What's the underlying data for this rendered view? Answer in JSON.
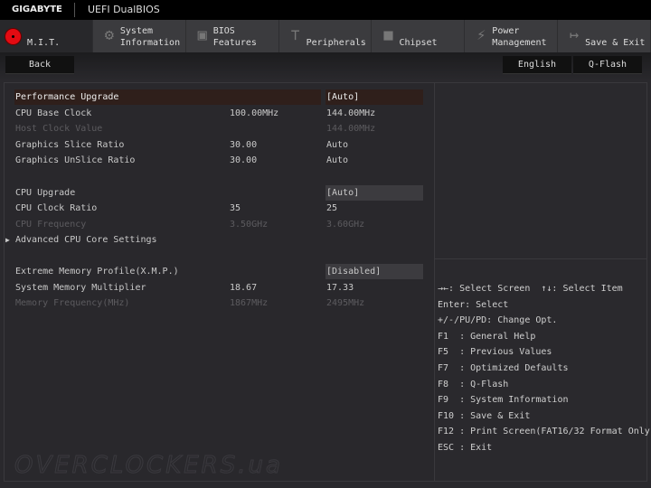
{
  "header": {
    "brand": "GIGABYTE",
    "title": "UEFI DualBIOS"
  },
  "tabs": [
    {
      "label1": "",
      "label2": "M.I.T.",
      "icon": "mit-icon"
    },
    {
      "label1": "System",
      "label2": "Information",
      "icon": "gear-icon"
    },
    {
      "label1": "BIOS",
      "label2": "Features",
      "icon": "bios-chip-icon"
    },
    {
      "label1": "",
      "label2": "Peripherals",
      "icon": "peripherals-icon"
    },
    {
      "label1": "",
      "label2": "Chipset",
      "icon": "chipset-icon"
    },
    {
      "label1": "Power",
      "label2": "Management",
      "icon": "power-icon"
    },
    {
      "label1": "",
      "label2": "Save & Exit",
      "icon": "exit-icon"
    }
  ],
  "toolbar": {
    "back": "Back",
    "language": "English",
    "qflash": "Q-Flash"
  },
  "settings": [
    {
      "name": "Performance Upgrade",
      "current": "",
      "value": "[Auto]",
      "state": "selected"
    },
    {
      "name": "CPU Base Clock",
      "current": "100.00MHz",
      "value": "144.00MHz",
      "state": "normal"
    },
    {
      "name": "Host Clock Value",
      "current": "",
      "value": "144.00MHz",
      "state": "disabled"
    },
    {
      "name": "Graphics Slice Ratio",
      "current": "30.00",
      "value": "Auto",
      "state": "normal"
    },
    {
      "name": "Graphics UnSlice Ratio",
      "current": "30.00",
      "value": "Auto",
      "state": "normal"
    },
    {
      "name": "CPU Upgrade",
      "current": "",
      "value": "[Auto]",
      "state": "box"
    },
    {
      "name": "CPU Clock Ratio",
      "current": "35",
      "value": "25",
      "state": "normal"
    },
    {
      "name": "CPU Frequency",
      "current": "3.50GHz",
      "value": "3.60GHz",
      "state": "disabled"
    },
    {
      "name": "Advanced CPU Core Settings",
      "current": "",
      "value": "",
      "state": "submenu"
    },
    {
      "name": "Extreme Memory Profile(X.M.P.)",
      "current": "",
      "value": "[Disabled]",
      "state": "box"
    },
    {
      "name": "System Memory Multiplier",
      "current": "18.67",
      "value": "17.33",
      "state": "normal"
    },
    {
      "name": "Memory Frequency(MHz)",
      "current": "1867MHz",
      "value": "2495MHz",
      "state": "disabled"
    }
  ],
  "help": [
    "→←: Select Screen  ↑↓: Select Item",
    "Enter: Select",
    "+/-/PU/PD: Change Opt.",
    "F1  : General Help",
    "F5  : Previous Values",
    "F7  : Optimized Defaults",
    "F8  : Q-Flash",
    "F9  : System Information",
    "F10 : Save & Exit",
    "F12 : Print Screen(FAT16/32 Format Only)",
    "ESC : Exit"
  ],
  "watermark": "OVERCLOCKERS.ua",
  "colors": {
    "accent": "#e30b12",
    "selected_bg": "#2f1f1b"
  }
}
